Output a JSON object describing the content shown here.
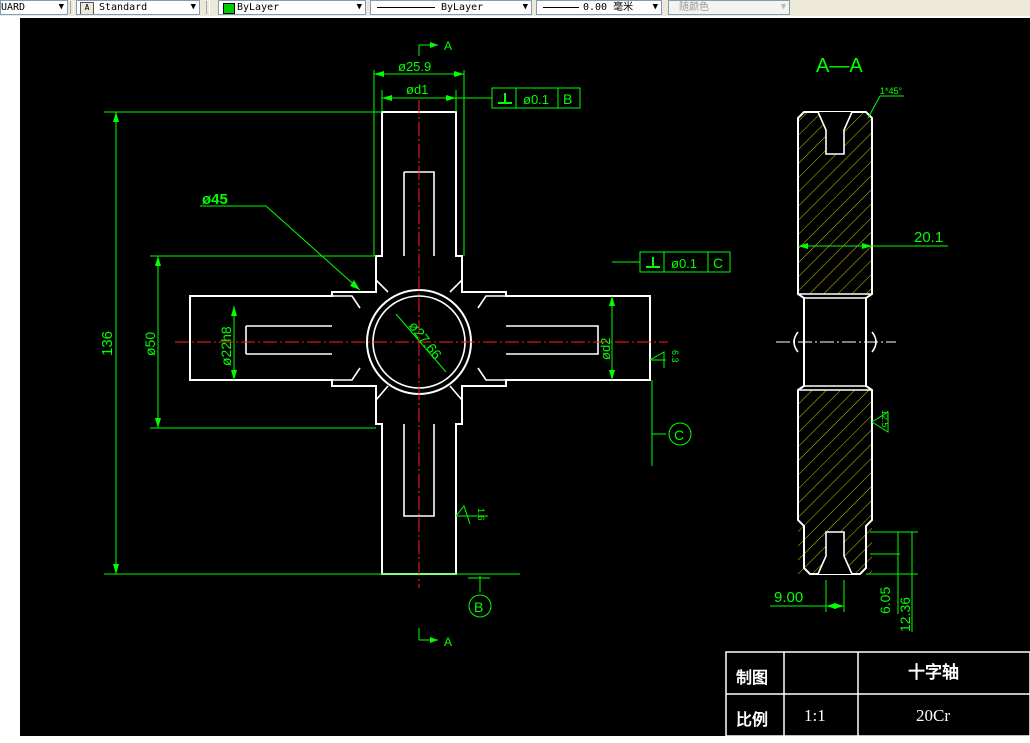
{
  "toolbar": {
    "style_name": "UARD",
    "text_style": "Standard",
    "layer": "ByLayer",
    "linetype": "ByLayer",
    "lineweight": "0.00 毫米",
    "color": "随颜色",
    "layer_color": "#00cc00"
  },
  "drawing": {
    "section_label": "A—A",
    "view_mark": "A",
    "datum_b": "B",
    "datum_c": "C",
    "tol_b_value": "ø0.1",
    "tol_c_value": "ø0.1",
    "dim_d25_9": "ø25.9",
    "dim_d1": "ød1",
    "dim_phi45": "ø45",
    "dim_136": "136",
    "dim_phi50": "ø50",
    "dim_phi22h8": "ø22h8",
    "dim_phi27_66": "ø27.66",
    "dim_d2": "ød2",
    "dim_20_1": "20.1",
    "dim_9_00": "9.00",
    "dim_6_05": "6.05",
    "dim_12_36": "12.36",
    "chamfer": "1*45°",
    "rough_6_3": "6.3",
    "rough_12_5": "12.5",
    "rough_1_6": "1.6"
  },
  "title_block": {
    "draw_label": "制图",
    "part_name": "十字轴",
    "scale_label": "比例",
    "scale_value": "1:1",
    "material": "20Cr"
  }
}
